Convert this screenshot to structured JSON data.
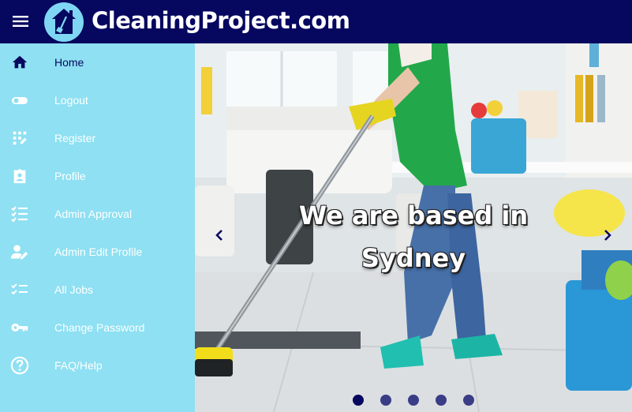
{
  "header": {
    "menu_icon": "hamburger-menu-icon",
    "logo_icon": "house-with-broom-icon",
    "brand": "CleaningProject.com"
  },
  "sidebar": {
    "items": [
      {
        "label": "Home",
        "icon": "home-icon",
        "active": true
      },
      {
        "label": "Logout",
        "icon": "toggle-icon",
        "active": false
      },
      {
        "label": "Register",
        "icon": "app-registration-icon",
        "active": false
      },
      {
        "label": "Profile",
        "icon": "assignment-ind-icon",
        "active": false
      },
      {
        "label": "Admin Approval",
        "icon": "checklist-icon",
        "active": false
      },
      {
        "label": "Admin Edit Profile",
        "icon": "person-edit-icon",
        "active": false
      },
      {
        "label": "All Jobs",
        "icon": "task-list-icon",
        "active": false
      },
      {
        "label": "Change Password",
        "icon": "key-icon",
        "active": false
      },
      {
        "label": "FAQ/Help",
        "icon": "help-circle-icon",
        "active": false
      }
    ]
  },
  "carousel": {
    "caption_line1": "We are based in",
    "caption_line2": "Sydney",
    "slide_count": 5,
    "active_slide": 1,
    "prev_icon": "chevron-left-icon",
    "next_icon": "chevron-right-icon"
  },
  "colors": {
    "header_bg": "#06075f",
    "sidebar_bg": "#8ee0f2",
    "logo_bg": "#7fd6f3",
    "active_text": "#06075f"
  }
}
